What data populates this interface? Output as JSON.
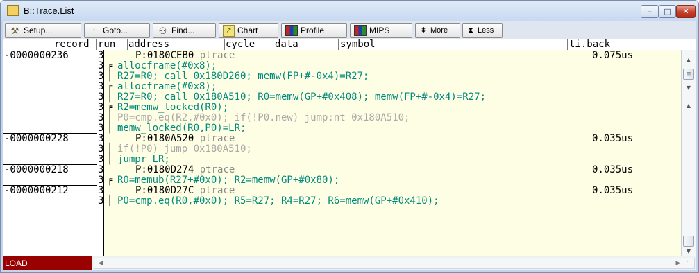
{
  "window": {
    "title": "B::Trace.List",
    "minimize_glyph": "–",
    "maximize_glyph": "□",
    "close_glyph": "✕"
  },
  "toolbar": {
    "buttons": [
      {
        "label": "Setup...",
        "icon": "wrench-icon",
        "glyph": "⚒"
      },
      {
        "label": "Goto...",
        "icon": "goto-icon",
        "glyph": "↑"
      },
      {
        "label": "Find...",
        "icon": "binoculars-icon",
        "glyph": "⚇"
      },
      {
        "label": "Chart",
        "icon": "chart-icon",
        "glyph": "↗"
      },
      {
        "label": "Profile",
        "icon": "profile-icon",
        "glyph": ""
      },
      {
        "label": "MIPS",
        "icon": "mips-icon",
        "glyph": ""
      },
      {
        "label": "More",
        "icon": "more-icon",
        "glyph": "⬍"
      },
      {
        "label": "Less",
        "icon": "less-icon",
        "glyph": "⧗"
      }
    ]
  },
  "table": {
    "headers": [
      "record",
      "run",
      "address",
      "cycle",
      "data",
      "symbol",
      "ti.back"
    ],
    "rows": [
      {
        "record": "-0000000236",
        "run": "3",
        "tree": "",
        "segments": [
          {
            "t": "P:0180CEB0",
            "c": "addr"
          },
          {
            "t": " ptrace",
            "c": "kw"
          }
        ],
        "ti": "0.075us",
        "sep_below": false
      },
      {
        "record": "",
        "run": "3",
        "tree": "╒",
        "segments": [
          {
            "t": "allocframe(#0x8);",
            "c": "teal"
          }
        ],
        "ti": "",
        "sep_below": false
      },
      {
        "record": "",
        "run": "3",
        "tree": "│",
        "segments": [
          {
            "t": "R27=R0; call 0x180D260; memw(FP+#-0x4)=R27;",
            "c": "teal"
          }
        ],
        "ti": "",
        "sep_below": false
      },
      {
        "record": "",
        "run": "3",
        "tree": "╒",
        "segments": [
          {
            "t": "allocframe(#0x8);",
            "c": "teal"
          }
        ],
        "ti": "",
        "sep_below": false
      },
      {
        "record": "",
        "run": "3",
        "tree": "│",
        "segments": [
          {
            "t": "R27=R0; call 0x180A510; R0=memw(GP+#0x408); memw(FP+#-0x4)=R27;",
            "c": "teal"
          }
        ],
        "ti": "",
        "sep_below": false
      },
      {
        "record": "",
        "run": "3",
        "tree": "╒",
        "segments": [
          {
            "t": "R2=memw_locked(R0);",
            "c": "teal"
          }
        ],
        "ti": "",
        "sep_below": false
      },
      {
        "record": "",
        "run": "3",
        "tree": "│",
        "segments": [
          {
            "t": "P0=cmp.eq(R2,#0x0); if(!P0.new) jump:nt 0x180A510;",
            "c": "gray"
          }
        ],
        "ti": "",
        "sep_below": false
      },
      {
        "record": "",
        "run": "3",
        "tree": "│",
        "segments": [
          {
            "t": "memw_locked(R0,P0)=LR;",
            "c": "teal"
          }
        ],
        "ti": "",
        "sep_below": true
      },
      {
        "record": "-0000000228",
        "run": "3",
        "tree": "",
        "segments": [
          {
            "t": "P:0180A520",
            "c": "addr"
          },
          {
            "t": " ptrace",
            "c": "kw"
          }
        ],
        "ti": "0.035us",
        "sep_below": false
      },
      {
        "record": "",
        "run": "3",
        "tree": "│",
        "segments": [
          {
            "t": "if(!P0) jump 0x180A510;",
            "c": "gray"
          }
        ],
        "ti": "",
        "sep_below": false
      },
      {
        "record": "",
        "run": "3",
        "tree": "│",
        "segments": [
          {
            "t": "jumpr LR;",
            "c": "teal"
          }
        ],
        "ti": "",
        "sep_below": true
      },
      {
        "record": "-0000000218",
        "run": "3",
        "tree": "",
        "segments": [
          {
            "t": "P:0180D274",
            "c": "addr"
          },
          {
            "t": " ptrace",
            "c": "kw"
          }
        ],
        "ti": "0.035us",
        "sep_below": false
      },
      {
        "record": "",
        "run": "3",
        "tree": "╒",
        "segments": [
          {
            "t": "R0=memub(R27+#0x0); R2=memw(GP+#0x80);",
            "c": "teal"
          }
        ],
        "ti": "",
        "sep_below": true
      },
      {
        "record": "-0000000212",
        "run": "3",
        "tree": "",
        "segments": [
          {
            "t": "P:0180D27C",
            "c": "addr"
          },
          {
            "t": " ptrace",
            "c": "kw"
          }
        ],
        "ti": "0.035us",
        "sep_below": false
      },
      {
        "record": "",
        "run": "3",
        "tree": "│",
        "segments": [
          {
            "t": "P0=cmp.eq(R0,#0x0); R5=R27; R4=R27; R6=memw(GP+#0x410);",
            "c": "teal"
          }
        ],
        "ti": "",
        "sep_below": false
      }
    ]
  },
  "status": {
    "state": "LOAD"
  },
  "colors": {
    "code_teal": "#008a7d",
    "code_gray": "#a8a8a8",
    "code_background": "#fefee4",
    "status_load": "#990000"
  }
}
